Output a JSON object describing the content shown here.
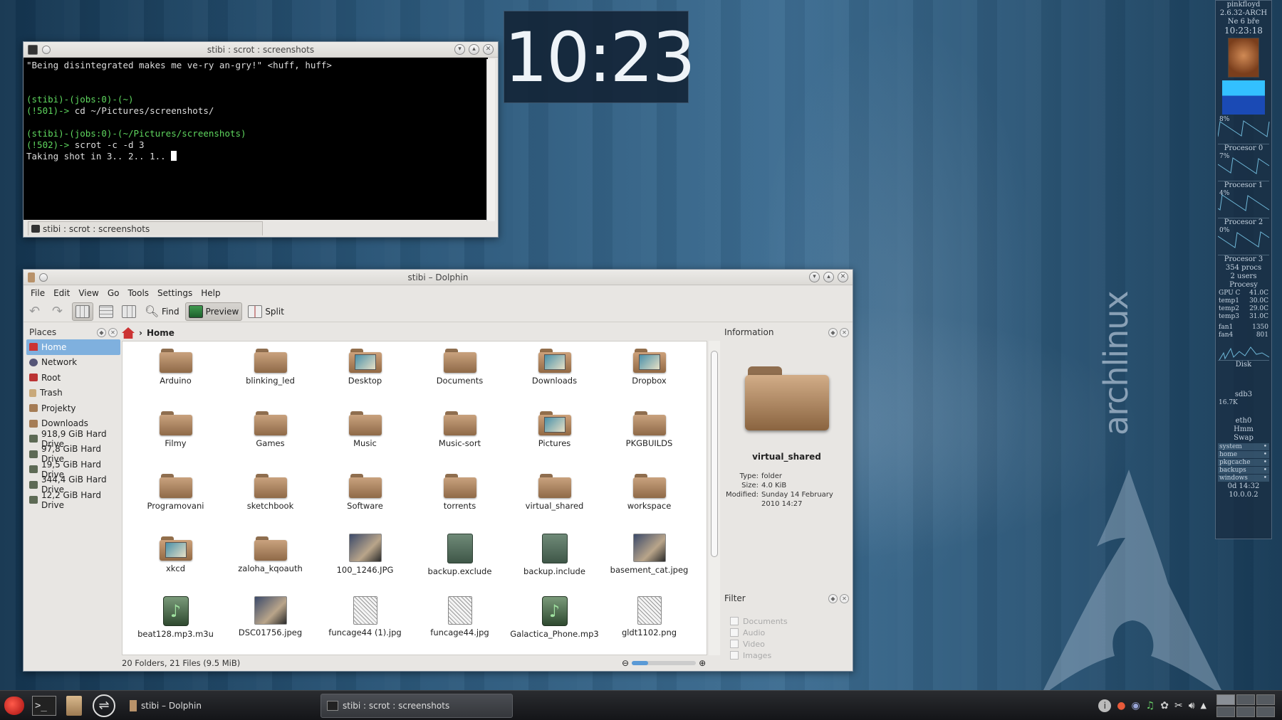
{
  "clock": {
    "time": "10:23"
  },
  "desktop": {
    "logo_text": "archlinux"
  },
  "terminal": {
    "title": "stibi : scrot : screenshots",
    "line1": "\"Being disintegrated makes me ve-ry an-gry!\" <huff, huff>",
    "prompt1_a": "(stibi)-(jobs:0)-(~)",
    "prompt1_b": "(!501)->",
    "cmd1": " cd ~/Pictures/screenshots/",
    "prompt2_a": "(stibi)-(jobs:0)-(~/Pictures/screenshots)",
    "prompt2_b": "(!502)->",
    "cmd2": " scrot -c -d 3",
    "output": "Taking shot in 3.. 2.. 1.. ",
    "tab_label": "stibi : scrot : screenshots"
  },
  "dolphin": {
    "title": "stibi – Dolphin",
    "menu": [
      "File",
      "Edit",
      "View",
      "Go",
      "Tools",
      "Settings",
      "Help"
    ],
    "toolbar": {
      "find": "Find",
      "preview": "Preview",
      "split": "Split"
    },
    "places_title": "Places",
    "places": [
      "Home",
      "Network",
      "Root",
      "Trash",
      "Projekty",
      "Downloads",
      "918,9 GiB Hard Drive",
      "97,8 GiB Hard Drive",
      "19,5 GiB Hard Drive",
      "344,4 GiB Hard Drive",
      "12,2 GiB Hard Drive"
    ],
    "breadcrumb": "Home",
    "files": [
      {
        "name": "Arduino",
        "kind": "folder"
      },
      {
        "name": "blinking_led",
        "kind": "folder"
      },
      {
        "name": "Desktop",
        "kind": "thumb"
      },
      {
        "name": "Documents",
        "kind": "folder"
      },
      {
        "name": "Downloads",
        "kind": "thumb"
      },
      {
        "name": "Dropbox",
        "kind": "thumb"
      },
      {
        "name": "Filmy",
        "kind": "folder"
      },
      {
        "name": "Games",
        "kind": "folder"
      },
      {
        "name": "Music",
        "kind": "folder"
      },
      {
        "name": "Music-sort",
        "kind": "folder"
      },
      {
        "name": "Pictures",
        "kind": "thumb"
      },
      {
        "name": "PKGBUILDS",
        "kind": "folder"
      },
      {
        "name": "Programovani",
        "kind": "folder"
      },
      {
        "name": "sketchbook",
        "kind": "folder"
      },
      {
        "name": "Software",
        "kind": "folder"
      },
      {
        "name": "torrents",
        "kind": "folder"
      },
      {
        "name": "virtual_shared",
        "kind": "folder"
      },
      {
        "name": "workspace",
        "kind": "folder"
      },
      {
        "name": "xkcd",
        "kind": "thumb"
      },
      {
        "name": "zaloha_kqoauth",
        "kind": "folder"
      },
      {
        "name": "100_1246.JPG",
        "kind": "photo"
      },
      {
        "name": "backup.exclude",
        "kind": "doc"
      },
      {
        "name": "backup.include",
        "kind": "doc"
      },
      {
        "name": "basement_cat.jpeg",
        "kind": "photo"
      },
      {
        "name": "beat128.mp3.m3u",
        "kind": "music"
      },
      {
        "name": "DSC01756.jpeg",
        "kind": "photo"
      },
      {
        "name": "funcage44 (1).jpg",
        "kind": "sketch"
      },
      {
        "name": "funcage44.jpg",
        "kind": "sketch"
      },
      {
        "name": "Galactica_Phone.mp3",
        "kind": "music"
      },
      {
        "name": "gldt1102.png",
        "kind": "sketch"
      }
    ],
    "status": "20 Folders, 21 Files (9.5 MiB)",
    "zoom_fraction": 0.25,
    "info_title": "Information",
    "info": {
      "name": "virtual_shared",
      "type_k": "Type:",
      "type_v": "folder",
      "size_k": "Size:",
      "size_v": "4.0 KiB",
      "mod_k": "Modified:",
      "mod_v": "Sunday 14 February 2010 14:27"
    },
    "filter_title": "Filter",
    "filters": [
      "Documents",
      "Audio",
      "Video",
      "Images"
    ]
  },
  "taskbar": {
    "tasks": [
      {
        "label": "stibi – Dolphin"
      },
      {
        "label": "stibi : scrot : screenshots"
      }
    ]
  },
  "conky": {
    "host": "pinkfloyd",
    "kernel": "2.6.32-ARCH",
    "date": "Ne  6 bře",
    "time": "10:23:18",
    "cpus": [
      {
        "pct": "8%",
        "label": "Procesor 0"
      },
      {
        "pct": "7%",
        "label": "Procesor 1"
      },
      {
        "pct": "4%",
        "label": "Procesor 2"
      },
      {
        "pct": "0%",
        "label": "Procesor 3"
      }
    ],
    "procs": "354 procs",
    "users": "2 users",
    "procesy": "Procesy",
    "temps": [
      {
        "k": "GPU C",
        "v": "41.0C"
      },
      {
        "k": "temp1",
        "v": "30.0C"
      },
      {
        "k": "temp2",
        "v": "29.0C"
      },
      {
        "k": "temp3",
        "v": "31.0C"
      }
    ],
    "fans": [
      {
        "k": "fan1",
        "v": "1350"
      },
      {
        "k": "fan4",
        "v": "801"
      }
    ],
    "disk": "Disk",
    "sdb3": "sdb3",
    "rate": "16.7K",
    "eth0": "eth0",
    "swap_a": "Hmm",
    "swap_b": "Swap",
    "fs": [
      "system",
      "home",
      "pkgcache",
      "backups",
      "windows"
    ],
    "uptime": "0d 14:32",
    "ip": "10.0.0.2"
  },
  "colors": {
    "accent": "#7fb0de",
    "terminal_prompt": "#5fd75f"
  }
}
